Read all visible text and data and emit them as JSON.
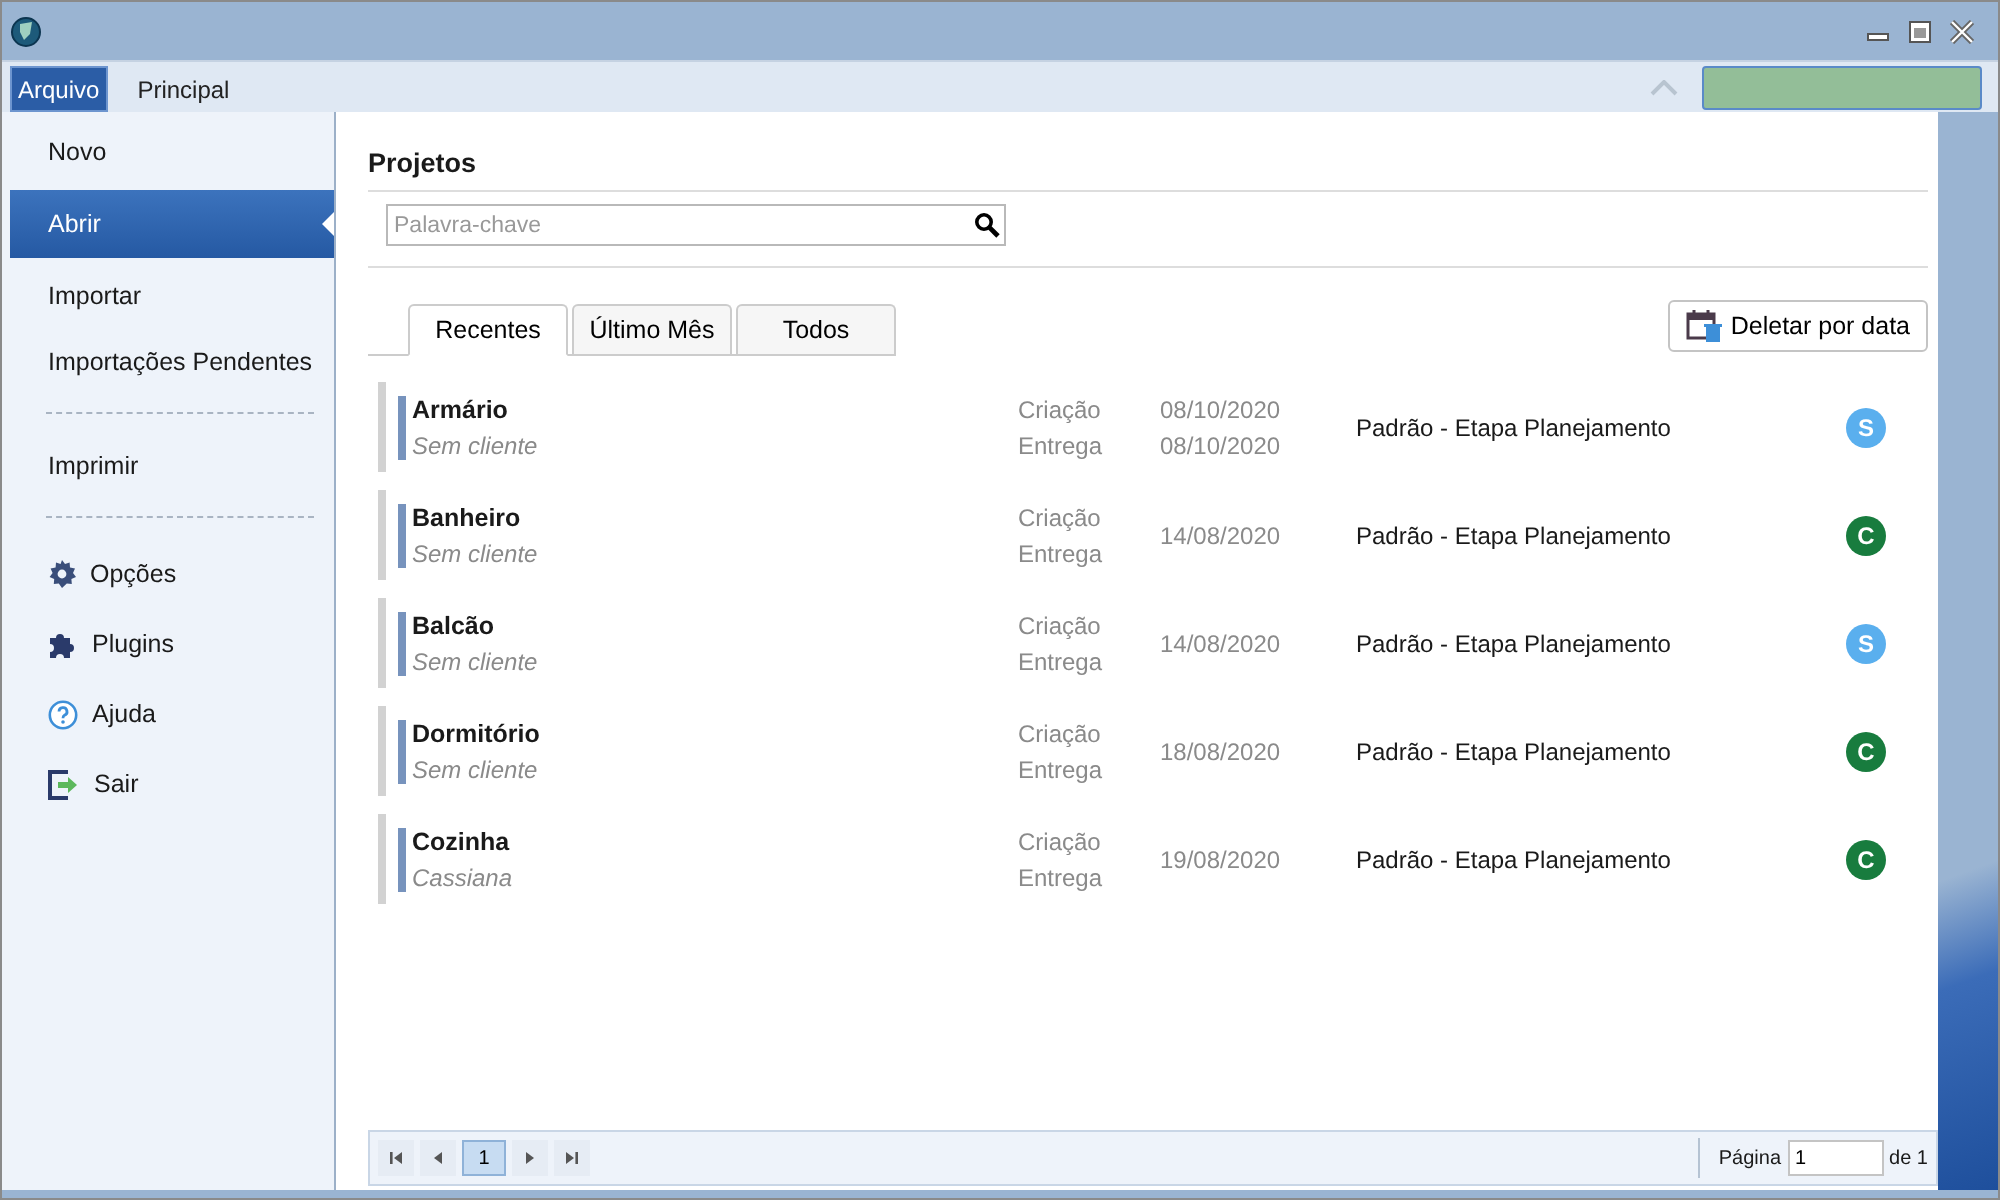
{
  "ribbon_tabs": [
    {
      "label": "Arquivo",
      "selected": true
    },
    {
      "label": "Principal",
      "selected": false
    }
  ],
  "menu_groups": [
    [
      {
        "label": "Novo",
        "selected": false
      },
      {
        "label": "Abrir",
        "selected": true
      },
      {
        "label": "Importar",
        "selected": false
      },
      {
        "label": "Importações Pendentes",
        "selected": false
      }
    ],
    [
      {
        "label": "Imprimir",
        "selected": false
      }
    ],
    [
      {
        "label": "Opções",
        "selected": false
      },
      {
        "label": "Plugins",
        "selected": false
      },
      {
        "label": "Ajuda",
        "selected": false
      },
      {
        "label": "Sair",
        "selected": false
      }
    ]
  ],
  "section_title": "Projetos",
  "search": {
    "placeholder": "Palavra-chave"
  },
  "tabs": [
    {
      "label": "Recentes",
      "selected": true
    },
    {
      "label": "Último Mês",
      "selected": false
    },
    {
      "label": "Todos",
      "selected": false
    }
  ],
  "delete_button": "Deletar por data",
  "projects": [
    {
      "name": "Armário",
      "client": "Sem cliente",
      "created_label": "Criação",
      "created": "08/10/2020",
      "delivery_label": "Entrega",
      "delivery": "08/10/2020",
      "template": "Padrão - Etapa Planejamento",
      "badge": "S",
      "color": "#5aafee"
    },
    {
      "name": "Banheiro",
      "client": "Sem cliente",
      "created_label": "Criação",
      "created": "14/08/2020",
      "delivery_label": "Entrega",
      "template": "Padrão - Etapa Planejamento",
      "badge": "C",
      "color": "#187c3e"
    },
    {
      "name": "Balcão",
      "client": "Sem cliente",
      "created_label": "Criação",
      "created": "14/08/2020",
      "delivery_label": "Entrega",
      "template": "Padrão - Etapa Planejamento",
      "badge": "S",
      "color": "#5aafee"
    },
    {
      "name": "Dormitório",
      "client": "Sem cliente",
      "created_label": "Criação",
      "created": "18/08/2020",
      "delivery_label": "Entrega",
      "template": "Padrão - Etapa Planejamento",
      "badge": "C",
      "color": "#187c3e"
    },
    {
      "name": "Cozinha",
      "client": "Cassiana",
      "created_label": "Criação",
      "created": "19/08/2020",
      "delivery_label": "Entrega",
      "template": "Padrão - Etapa Planejamento",
      "badge": "C",
      "color": "#187c3e"
    }
  ],
  "pager": {
    "pages": [
      {
        "label": "1",
        "selected": true
      }
    ],
    "page_label": "Página",
    "page_value": "1",
    "total": "de 1"
  }
}
